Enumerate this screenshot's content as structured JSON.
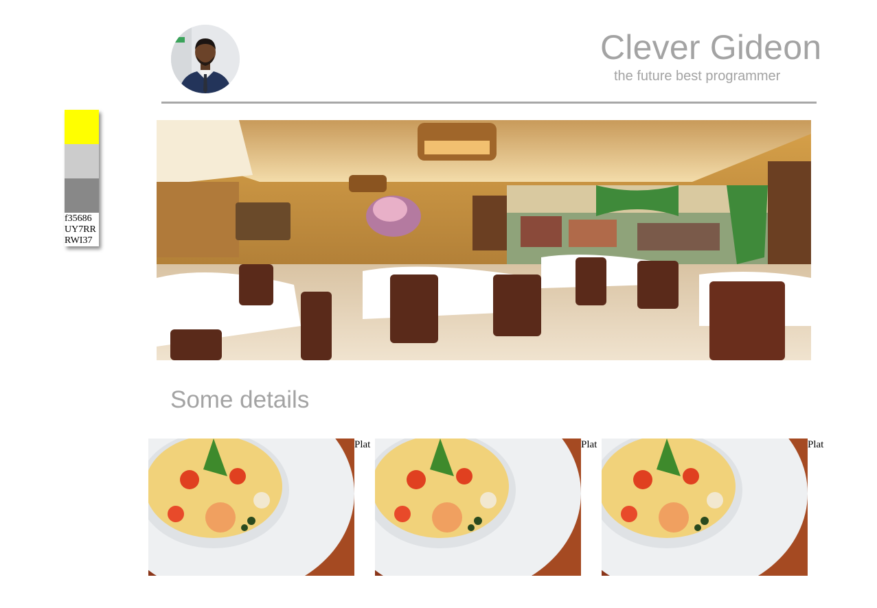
{
  "header": {
    "name": "Clever Gideon",
    "tagline": "the future best programmer",
    "avatar_icon": "person-portrait-icon"
  },
  "palette": {
    "colors": [
      "#ffff00",
      "#cccccc",
      "#888888"
    ],
    "codes": [
      "f35686",
      "UY7RR",
      "RWI37"
    ]
  },
  "hero": {
    "image": "restaurant-dining-room-photo"
  },
  "details": {
    "title": "Some details",
    "items": [
      {
        "image": "seafood-pasta-plate-photo",
        "caption": "Plat"
      },
      {
        "image": "seafood-pasta-plate-photo",
        "caption": "Plat"
      },
      {
        "image": "seafood-pasta-plate-photo",
        "caption": "Plat"
      }
    ]
  }
}
